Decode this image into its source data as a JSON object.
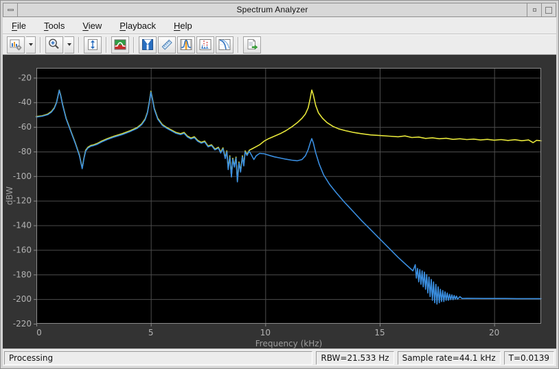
{
  "window": {
    "title": "Spectrum Analyzer"
  },
  "menubar": {
    "items": [
      {
        "label": "File",
        "mnemonic": "F"
      },
      {
        "label": "Tools",
        "mnemonic": "T"
      },
      {
        "label": "View",
        "mnemonic": "V"
      },
      {
        "label": "Playback",
        "mnemonic": "P"
      },
      {
        "label": "Help",
        "mnemonic": "H"
      }
    ]
  },
  "toolbar": {
    "buttons": [
      {
        "name": "configuration",
        "icon": "chart-gear-icon",
        "has_dropdown": true
      },
      {
        "name": "zoom-in",
        "icon": "magnifier-plus-icon",
        "has_dropdown": true
      },
      {
        "name": "fit-to-view",
        "icon": "vertical-fit-icon"
      },
      {
        "name": "spectrum-settings",
        "icon": "spectrum-red-green-icon"
      },
      {
        "name": "spectral-mask",
        "icon": "blue-mask-icon"
      },
      {
        "name": "cursor-measurements",
        "icon": "ruler-icon"
      },
      {
        "name": "peak-finder",
        "icon": "peak-band-icon"
      },
      {
        "name": "distortion-measurements",
        "icon": "distortion-dashed-icon"
      },
      {
        "name": "ccdf-measurements",
        "icon": "ccdf-curves-icon"
      },
      {
        "name": "playback-export",
        "icon": "document-green-arrow-icon"
      }
    ]
  },
  "statusbar": {
    "processing": "Processing",
    "rbw": "RBW=21.533 Hz",
    "sample_rate": "Sample rate=44.1 kHz",
    "time": "T=0.0139"
  },
  "colors": {
    "figure_bg": "#333333",
    "axes_bg": "#000000",
    "grid": "#4d4d4d",
    "frame": "#8c8c8c",
    "tick_label": "#b3b3b3",
    "axis_label": "#9e9e9e",
    "trace_yellow": "#e6e63a",
    "trace_blue": "#3a8ee0"
  },
  "chart_data": {
    "type": "line",
    "title": "",
    "xlabel": "Frequency (kHz)",
    "ylabel": "dBW",
    "xlim": [
      0,
      22.05
    ],
    "ylim": [
      -220,
      -12
    ],
    "x_ticks": [
      0,
      5,
      10,
      15,
      20
    ],
    "y_ticks": [
      -20,
      -40,
      -60,
      -80,
      -100,
      -120,
      -140,
      -160,
      -180,
      -200,
      -220
    ],
    "grid": true,
    "legend": "none",
    "series": [
      {
        "name": "yellow-trace",
        "color": "#e6e63a",
        "points": [
          [
            0,
            -51.5
          ],
          [
            0.25,
            -51
          ],
          [
            0.5,
            -49.5
          ],
          [
            0.65,
            -47.5
          ],
          [
            0.78,
            -44.5
          ],
          [
            0.88,
            -40
          ],
          [
            0.95,
            -34
          ],
          [
            1.0,
            -30
          ],
          [
            1.06,
            -34
          ],
          [
            1.15,
            -42
          ],
          [
            1.3,
            -53
          ],
          [
            1.5,
            -63
          ],
          [
            1.7,
            -73
          ],
          [
            1.88,
            -83
          ],
          [
            2.0,
            -93.5
          ],
          [
            2.07,
            -86
          ],
          [
            2.15,
            -79
          ],
          [
            2.25,
            -76.5
          ],
          [
            2.38,
            -75
          ],
          [
            2.5,
            -74.5
          ],
          [
            2.65,
            -73.5
          ],
          [
            2.85,
            -71.5
          ],
          [
            3.1,
            -69.5
          ],
          [
            3.4,
            -67.5
          ],
          [
            3.75,
            -65.5
          ],
          [
            4.1,
            -63
          ],
          [
            4.4,
            -60.5
          ],
          [
            4.6,
            -57.5
          ],
          [
            4.75,
            -53.5
          ],
          [
            4.85,
            -48
          ],
          [
            4.93,
            -40
          ],
          [
            5.0,
            -31
          ],
          [
            5.07,
            -37
          ],
          [
            5.15,
            -45
          ],
          [
            5.3,
            -53
          ],
          [
            5.5,
            -58
          ],
          [
            5.7,
            -60.5
          ],
          [
            5.9,
            -62.5
          ],
          [
            6.1,
            -64.5
          ],
          [
            6.3,
            -65.5
          ],
          [
            6.45,
            -64.5
          ],
          [
            6.6,
            -67.5
          ],
          [
            6.75,
            -69
          ],
          [
            6.9,
            -68
          ],
          [
            7.05,
            -71
          ],
          [
            7.2,
            -72.5
          ],
          [
            7.35,
            -71.5
          ],
          [
            7.5,
            -75.5
          ],
          [
            7.65,
            -74.5
          ],
          [
            7.8,
            -78
          ],
          [
            7.95,
            -76.5
          ],
          [
            8.05,
            -80.5
          ],
          [
            8.15,
            -77
          ],
          [
            8.25,
            -85
          ],
          [
            8.32,
            -79.5
          ],
          [
            8.38,
            -94
          ],
          [
            8.45,
            -83.5
          ],
          [
            8.52,
            -100
          ],
          [
            8.58,
            -85.5
          ],
          [
            8.65,
            -92
          ],
          [
            8.72,
            -84.5
          ],
          [
            8.78,
            -104
          ],
          [
            8.85,
            -88.5
          ],
          [
            8.92,
            -96
          ],
          [
            9.0,
            -83.5
          ],
          [
            9.06,
            -91
          ],
          [
            9.12,
            -79.5
          ],
          [
            9.2,
            -82.5
          ],
          [
            9.3,
            -79
          ],
          [
            9.45,
            -77.5
          ],
          [
            9.6,
            -76
          ],
          [
            9.75,
            -74.5
          ],
          [
            9.95,
            -71.5
          ],
          [
            10.15,
            -69.5
          ],
          [
            10.4,
            -67.5
          ],
          [
            10.65,
            -65.5
          ],
          [
            10.9,
            -63
          ],
          [
            11.15,
            -60
          ],
          [
            11.4,
            -56.5
          ],
          [
            11.6,
            -53
          ],
          [
            11.75,
            -49.5
          ],
          [
            11.87,
            -44.5
          ],
          [
            11.95,
            -38
          ],
          [
            12.03,
            -30
          ],
          [
            12.1,
            -34
          ],
          [
            12.2,
            -42.5
          ],
          [
            12.32,
            -48.5
          ],
          [
            12.5,
            -53
          ],
          [
            12.7,
            -56.5
          ],
          [
            12.95,
            -59.5
          ],
          [
            13.2,
            -61.5
          ],
          [
            13.5,
            -63
          ],
          [
            13.85,
            -64.5
          ],
          [
            14.2,
            -65.5
          ],
          [
            14.6,
            -66.5
          ],
          [
            15.0,
            -67
          ],
          [
            15.4,
            -67.5
          ],
          [
            15.8,
            -68
          ],
          [
            16.1,
            -67.3
          ],
          [
            16.4,
            -68.6
          ],
          [
            16.7,
            -68.2
          ],
          [
            17.0,
            -69.3
          ],
          [
            17.3,
            -68.8
          ],
          [
            17.6,
            -69.6
          ],
          [
            17.9,
            -69.2
          ],
          [
            18.2,
            -70.1
          ],
          [
            18.5,
            -69.6
          ],
          [
            18.8,
            -70.3
          ],
          [
            19.1,
            -69.9
          ],
          [
            19.4,
            -70.6
          ],
          [
            19.7,
            -70.1
          ],
          [
            20.0,
            -70.8
          ],
          [
            20.3,
            -70.3
          ],
          [
            20.6,
            -71
          ],
          [
            20.9,
            -70.4
          ],
          [
            21.2,
            -71.2
          ],
          [
            21.5,
            -70.6
          ],
          [
            21.7,
            -72.8
          ],
          [
            21.85,
            -70.9
          ],
          [
            22.05,
            -71.3
          ]
        ]
      },
      {
        "name": "blue-trace",
        "color": "#3a8ee0",
        "points": [
          [
            0,
            -52
          ],
          [
            0.25,
            -51.3
          ],
          [
            0.5,
            -50
          ],
          [
            0.65,
            -48
          ],
          [
            0.78,
            -45
          ],
          [
            0.88,
            -40.5
          ],
          [
            0.95,
            -34.5
          ],
          [
            1.0,
            -30.2
          ],
          [
            1.06,
            -34.5
          ],
          [
            1.15,
            -42.5
          ],
          [
            1.3,
            -53.5
          ],
          [
            1.5,
            -63.5
          ],
          [
            1.7,
            -73.5
          ],
          [
            1.88,
            -83.5
          ],
          [
            2.0,
            -94
          ],
          [
            2.07,
            -86.5
          ],
          [
            2.15,
            -79.7
          ],
          [
            2.25,
            -77.2
          ],
          [
            2.38,
            -75.7
          ],
          [
            2.5,
            -75.2
          ],
          [
            2.65,
            -74.2
          ],
          [
            2.85,
            -72.2
          ],
          [
            3.1,
            -70.2
          ],
          [
            3.4,
            -68.2
          ],
          [
            3.75,
            -66.2
          ],
          [
            4.1,
            -63.7
          ],
          [
            4.4,
            -61.2
          ],
          [
            4.6,
            -58.2
          ],
          [
            4.75,
            -54.2
          ],
          [
            4.85,
            -48.7
          ],
          [
            4.93,
            -40.7
          ],
          [
            5.0,
            -31.7
          ],
          [
            5.07,
            -37.7
          ],
          [
            5.15,
            -45.7
          ],
          [
            5.3,
            -53.7
          ],
          [
            5.5,
            -58.7
          ],
          [
            5.7,
            -61.2
          ],
          [
            5.9,
            -63.2
          ],
          [
            6.1,
            -65.2
          ],
          [
            6.3,
            -66.2
          ],
          [
            6.45,
            -65.2
          ],
          [
            6.6,
            -68.2
          ],
          [
            6.75,
            -69.7
          ],
          [
            6.9,
            -68.7
          ],
          [
            7.05,
            -71.7
          ],
          [
            7.2,
            -73.2
          ],
          [
            7.35,
            -72.2
          ],
          [
            7.5,
            -76.2
          ],
          [
            7.65,
            -75.2
          ],
          [
            7.8,
            -78.7
          ],
          [
            7.95,
            -77.2
          ],
          [
            8.05,
            -81.2
          ],
          [
            8.15,
            -77.7
          ],
          [
            8.25,
            -85.7
          ],
          [
            8.32,
            -80.2
          ],
          [
            8.38,
            -94.7
          ],
          [
            8.45,
            -84.2
          ],
          [
            8.52,
            -100.7
          ],
          [
            8.58,
            -86.2
          ],
          [
            8.65,
            -92.7
          ],
          [
            8.72,
            -85.2
          ],
          [
            8.78,
            -104.7
          ],
          [
            8.85,
            -89.2
          ],
          [
            8.92,
            -96.7
          ],
          [
            9.0,
            -84.2
          ],
          [
            9.06,
            -91.7
          ],
          [
            9.12,
            -80.2
          ],
          [
            9.2,
            -83.2
          ],
          [
            9.3,
            -79.7
          ],
          [
            9.4,
            -83
          ],
          [
            9.5,
            -86.5
          ],
          [
            9.6,
            -83.5
          ],
          [
            9.75,
            -81.5
          ],
          [
            9.95,
            -81.8
          ],
          [
            10.15,
            -83
          ],
          [
            10.4,
            -84.3
          ],
          [
            10.65,
            -85.3
          ],
          [
            10.9,
            -86.2
          ],
          [
            11.15,
            -87
          ],
          [
            11.4,
            -87.5
          ],
          [
            11.6,
            -86.5
          ],
          [
            11.75,
            -83.5
          ],
          [
            11.87,
            -78.5
          ],
          [
            11.97,
            -72.5
          ],
          [
            12.03,
            -69.5
          ],
          [
            12.1,
            -73
          ],
          [
            12.2,
            -81
          ],
          [
            12.35,
            -90
          ],
          [
            12.55,
            -99
          ],
          [
            12.8,
            -106.5
          ],
          [
            13.1,
            -113.5
          ],
          [
            13.45,
            -121
          ],
          [
            13.8,
            -128
          ],
          [
            14.2,
            -136
          ],
          [
            14.6,
            -143.5
          ],
          [
            15.0,
            -151
          ],
          [
            15.4,
            -158.5
          ],
          [
            15.8,
            -166
          ],
          [
            16.15,
            -172
          ],
          [
            16.45,
            -177
          ],
          [
            16.55,
            -172
          ],
          [
            16.6,
            -183
          ],
          [
            16.65,
            -175
          ],
          [
            16.7,
            -186
          ],
          [
            16.75,
            -176
          ],
          [
            16.8,
            -188
          ],
          [
            16.85,
            -177
          ],
          [
            16.9,
            -190
          ],
          [
            16.95,
            -178
          ],
          [
            17.0,
            -192
          ],
          [
            17.05,
            -180
          ],
          [
            17.1,
            -195
          ],
          [
            17.15,
            -182
          ],
          [
            17.2,
            -198
          ],
          [
            17.25,
            -184
          ],
          [
            17.3,
            -201
          ],
          [
            17.35,
            -186
          ],
          [
            17.4,
            -203
          ],
          [
            17.45,
            -188
          ],
          [
            17.5,
            -204
          ],
          [
            17.55,
            -190
          ],
          [
            17.6,
            -203
          ],
          [
            17.65,
            -192
          ],
          [
            17.7,
            -202
          ],
          [
            17.75,
            -193
          ],
          [
            17.8,
            -202
          ],
          [
            17.85,
            -194
          ],
          [
            17.9,
            -201
          ],
          [
            17.95,
            -195
          ],
          [
            18.0,
            -201
          ],
          [
            18.05,
            -196
          ],
          [
            18.1,
            -200.5
          ],
          [
            18.15,
            -196.5
          ],
          [
            18.2,
            -200.5
          ],
          [
            18.25,
            -197
          ],
          [
            18.3,
            -200
          ],
          [
            18.35,
            -197.5
          ],
          [
            18.4,
            -200
          ],
          [
            18.5,
            -198
          ],
          [
            18.6,
            -199.5
          ],
          [
            18.8,
            -199.3
          ],
          [
            19.2,
            -199.4
          ],
          [
            19.6,
            -199.5
          ],
          [
            20.0,
            -199.5
          ],
          [
            20.5,
            -199.5
          ],
          [
            21.0,
            -199.6
          ],
          [
            21.5,
            -199.6
          ],
          [
            22.05,
            -199.6
          ]
        ]
      }
    ]
  }
}
